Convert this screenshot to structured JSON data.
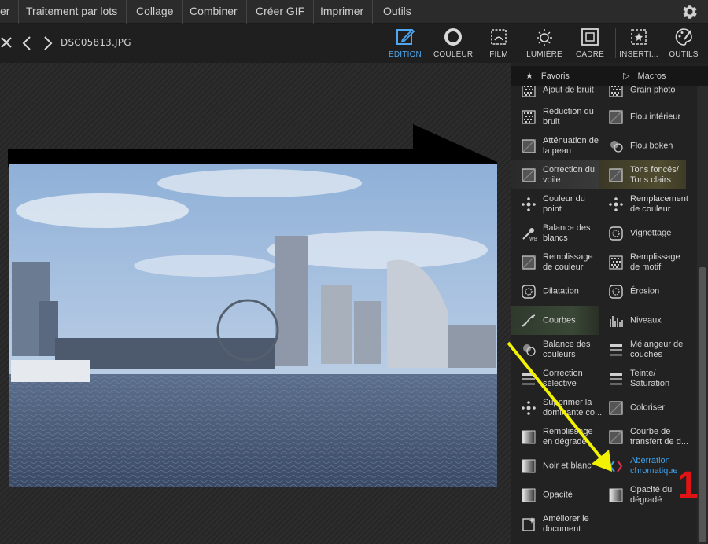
{
  "menubar": {
    "items": [
      "er",
      "Traitement par lots",
      "Collage",
      "Combiner",
      "Créer GIF",
      "Imprimer",
      "Outils"
    ],
    "settings_icon": "gear-icon"
  },
  "toolbar": {
    "filename": "DSC05813.JPG",
    "tools": [
      {
        "label": "EDITION",
        "icon": "edit-icon",
        "active": true
      },
      {
        "label": "COULEUR",
        "icon": "color-ring-icon",
        "active": false
      },
      {
        "label": "FILM",
        "icon": "film-icon",
        "active": false
      },
      {
        "label": "LUMIÈRE",
        "icon": "sun-icon",
        "active": false
      },
      {
        "label": "CADRE",
        "icon": "frame-icon",
        "active": false
      },
      {
        "label": "INSERTI...",
        "icon": "insert-icon",
        "active": false
      },
      {
        "label": "OUTILS",
        "icon": "palette-tools-icon",
        "active": false
      }
    ]
  },
  "panel": {
    "tabs": [
      {
        "label": "Favoris",
        "icon": "star-icon"
      },
      {
        "label": "Macros",
        "icon": "play-icon"
      }
    ],
    "effects": [
      {
        "label": "Ajout de bruit",
        "icon": "noise-add-icon"
      },
      {
        "label": "Grain photo",
        "icon": "grain-icon"
      },
      {
        "label": "Réduction du bruit",
        "icon": "noise-reduce-icon"
      },
      {
        "label": "Flou intérieur",
        "icon": "inner-blur-icon"
      },
      {
        "label": "Atténuation de la peau",
        "icon": "skin-smooth-icon"
      },
      {
        "label": "Flou bokeh",
        "icon": "bokeh-icon"
      },
      {
        "label": "Correction du voile",
        "icon": "dehaze-icon"
      },
      {
        "label": "Tons foncés/ Tons clairs",
        "icon": "shadows-highlights-icon"
      },
      {
        "label": "Couleur du point",
        "icon": "color-point-icon"
      },
      {
        "label": "Remplacement de couleur",
        "icon": "color-replace-icon"
      },
      {
        "label": "Balance des blancs",
        "icon": "white-balance-icon"
      },
      {
        "label": "Vignettage",
        "icon": "vignette-icon"
      },
      {
        "label": "Remplissage de couleur",
        "icon": "color-fill-icon"
      },
      {
        "label": "Remplissage de motif",
        "icon": "pattern-fill-icon"
      },
      {
        "label": "Dilatation",
        "icon": "dilate-icon"
      },
      {
        "label": "Érosion",
        "icon": "erosion-icon"
      },
      {
        "label": "Courbes",
        "icon": "curves-icon"
      },
      {
        "label": "Niveaux",
        "icon": "levels-icon"
      },
      {
        "label": "Balance des couleurs",
        "icon": "color-balance-icon"
      },
      {
        "label": "Mélangeur de couches",
        "icon": "channel-mixer-icon"
      },
      {
        "label": "Correction sélective",
        "icon": "selective-correction-icon"
      },
      {
        "label": "Teinte/ Saturation",
        "icon": "hue-saturation-icon"
      },
      {
        "label": "Supprimer la dominante co...",
        "icon": "remove-cast-icon"
      },
      {
        "label": "Coloriser",
        "icon": "colorize-icon"
      },
      {
        "label": "Remplissage en dégradé",
        "icon": "gradient-fill-icon"
      },
      {
        "label": "Courbe de transfert de d...",
        "icon": "transfer-curve-icon"
      },
      {
        "label": "Noir et blanc",
        "icon": "black-white-icon"
      },
      {
        "label": "Aberration chromatique",
        "icon": "chromatic-aberration-icon"
      },
      {
        "label": "Opacité",
        "icon": "opacity-icon"
      },
      {
        "label": "Opacité du dégradé",
        "icon": "gradient-opacity-icon"
      },
      {
        "label": "Améliorer le document",
        "icon": "enhance-document-icon"
      }
    ]
  },
  "annotation": {
    "number": "1",
    "arrow_color": "#f2f200",
    "number_color": "#e01414"
  },
  "colors": {
    "accent": "#3fa3ee",
    "highlight_green": "#3a4736",
    "highlight_olive": "#504c30"
  }
}
